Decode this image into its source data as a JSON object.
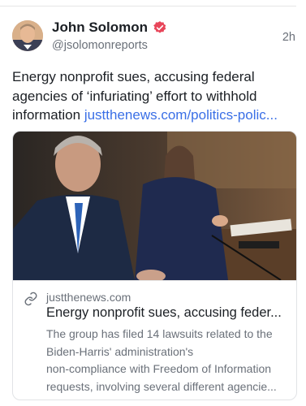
{
  "post": {
    "author_name": "John Solomon",
    "author_handle": "@jsolomonreports",
    "time": "2h",
    "text": "Energy nonprofit sues, accusing federal agencies of ‘infuriating’ effort to withhold information ",
    "link_text": "justthenews.com/politics-polic..."
  },
  "card": {
    "domain": "justthenews.com",
    "title": "Energy nonprofit sues, accusing feder...",
    "description_lines": [
      "The group has filed 14 lawsuits related to the",
      "Biden-Harris' administration's",
      "non-compliance with Freedom of Information",
      "requests, involving several different agencie..."
    ]
  },
  "colors": {
    "verified": "#e8465a",
    "link": "#3a6fe6",
    "secondary_text": "#6a7079"
  },
  "icons": {
    "verified": "verified-badge-icon",
    "link": "link-icon"
  }
}
